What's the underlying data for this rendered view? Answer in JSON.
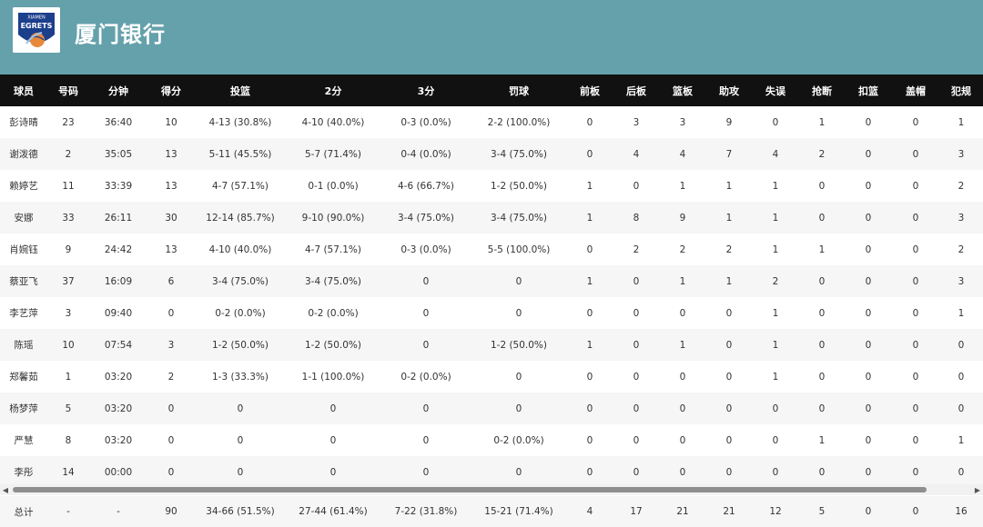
{
  "team": {
    "name": "厦门银行",
    "logo_text": "EGRETS"
  },
  "columns": [
    "球员",
    "号码",
    "分钟",
    "得分",
    "投篮",
    "2分",
    "3分",
    "罚球",
    "前板",
    "后板",
    "篮板",
    "助攻",
    "失误",
    "抢断",
    "扣篮",
    "盖帽",
    "犯规"
  ],
  "rows": [
    [
      "彭诗晴",
      "23",
      "36:40",
      "10",
      "4-13 (30.8%)",
      "4-10 (40.0%)",
      "0-3 (0.0%)",
      "2-2 (100.0%)",
      "0",
      "3",
      "3",
      "9",
      "0",
      "1",
      "0",
      "0",
      "1"
    ],
    [
      "谢泼德",
      "2",
      "35:05",
      "13",
      "5-11 (45.5%)",
      "5-7 (71.4%)",
      "0-4 (0.0%)",
      "3-4 (75.0%)",
      "0",
      "4",
      "4",
      "7",
      "4",
      "2",
      "0",
      "0",
      "3"
    ],
    [
      "赖婷艺",
      "11",
      "33:39",
      "13",
      "4-7 (57.1%)",
      "0-1 (0.0%)",
      "4-6 (66.7%)",
      "1-2 (50.0%)",
      "1",
      "0",
      "1",
      "1",
      "1",
      "0",
      "0",
      "0",
      "2"
    ],
    [
      "安娜",
      "33",
      "26:11",
      "30",
      "12-14 (85.7%)",
      "9-10 (90.0%)",
      "3-4 (75.0%)",
      "3-4 (75.0%)",
      "1",
      "8",
      "9",
      "1",
      "1",
      "0",
      "0",
      "0",
      "3"
    ],
    [
      "肖婉钰",
      "9",
      "24:42",
      "13",
      "4-10 (40.0%)",
      "4-7 (57.1%)",
      "0-3 (0.0%)",
      "5-5 (100.0%)",
      "0",
      "2",
      "2",
      "2",
      "1",
      "1",
      "0",
      "0",
      "2"
    ],
    [
      "蔡亚飞",
      "37",
      "16:09",
      "6",
      "3-4 (75.0%)",
      "3-4 (75.0%)",
      "0",
      "0",
      "1",
      "0",
      "1",
      "1",
      "2",
      "0",
      "0",
      "0",
      "3"
    ],
    [
      "李艺萍",
      "3",
      "09:40",
      "0",
      "0-2 (0.0%)",
      "0-2 (0.0%)",
      "0",
      "0",
      "0",
      "0",
      "0",
      "0",
      "1",
      "0",
      "0",
      "0",
      "1"
    ],
    [
      "陈瑶",
      "10",
      "07:54",
      "3",
      "1-2 (50.0%)",
      "1-2 (50.0%)",
      "0",
      "1-2 (50.0%)",
      "1",
      "0",
      "1",
      "0",
      "1",
      "0",
      "0",
      "0",
      "0"
    ],
    [
      "郑馨茹",
      "1",
      "03:20",
      "2",
      "1-3 (33.3%)",
      "1-1 (100.0%)",
      "0-2 (0.0%)",
      "0",
      "0",
      "0",
      "0",
      "0",
      "1",
      "0",
      "0",
      "0",
      "0"
    ],
    [
      "杨梦萍",
      "5",
      "03:20",
      "0",
      "0",
      "0",
      "0",
      "0",
      "0",
      "0",
      "0",
      "0",
      "0",
      "0",
      "0",
      "0",
      "0"
    ],
    [
      "严慧",
      "8",
      "03:20",
      "0",
      "0",
      "0",
      "0",
      "0-2 (0.0%)",
      "0",
      "0",
      "0",
      "0",
      "0",
      "1",
      "0",
      "0",
      "1"
    ],
    [
      "李彤",
      "14",
      "00:00",
      "0",
      "0",
      "0",
      "0",
      "0",
      "0",
      "0",
      "0",
      "0",
      "0",
      "0",
      "0",
      "0",
      "0"
    ]
  ],
  "totals": [
    "总计",
    "-",
    "-",
    "90",
    "34-66 (51.5%)",
    "27-44 (61.4%)",
    "7-22 (31.8%)",
    "15-21 (71.4%)",
    "4",
    "17",
    "21",
    "21",
    "12",
    "5",
    "0",
    "0",
    "16"
  ],
  "colors": {
    "header_bg": "#65a1ab",
    "table_header_bg": "#111111",
    "logo_blue": "#1c3f8c",
    "logo_orange": "#e8893a"
  }
}
